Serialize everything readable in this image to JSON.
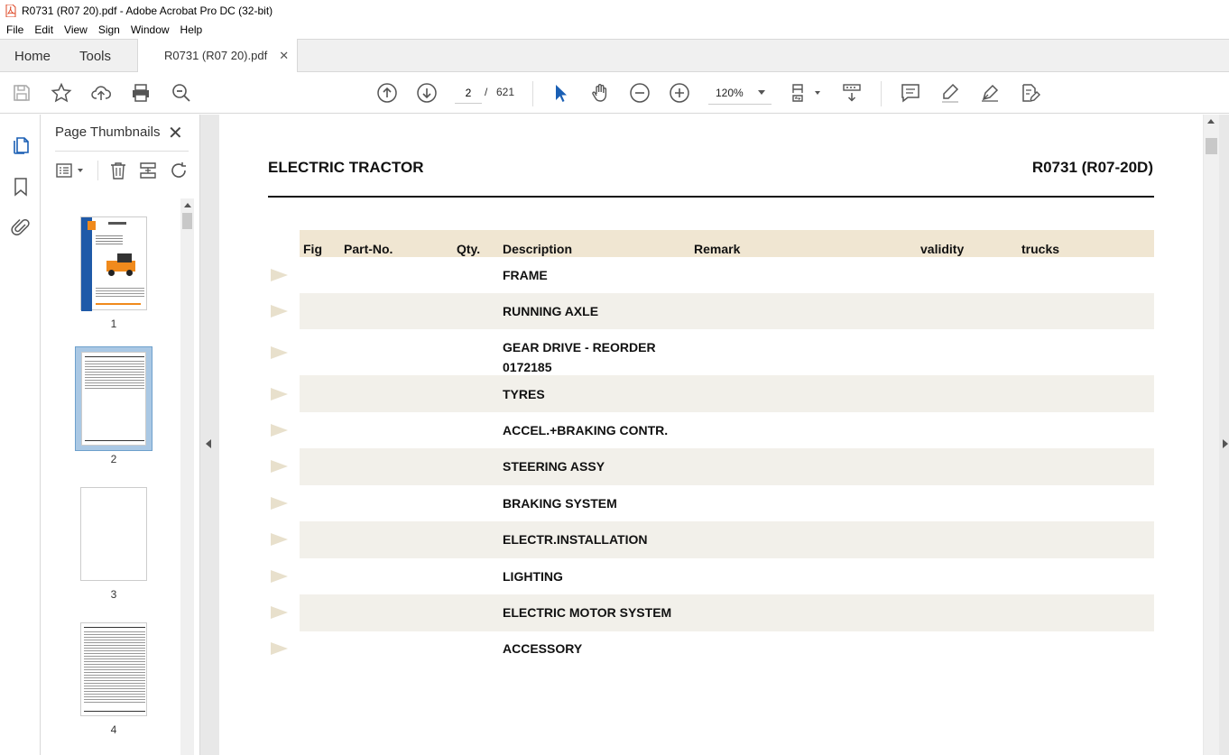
{
  "window": {
    "title": "R0731 (R07 20).pdf - Adobe Acrobat Pro DC (32-bit)"
  },
  "menu": [
    "File",
    "Edit",
    "View",
    "Sign",
    "Window",
    "Help"
  ],
  "tabs": {
    "home": "Home",
    "tools": "Tools",
    "document": "R0731 (R07 20).pdf"
  },
  "toolbar": {
    "page_current": "2",
    "page_separator": "/",
    "page_total": "621",
    "zoom": "120%"
  },
  "thumbnails": {
    "title": "Page Thumbnails",
    "pages": [
      "1",
      "2",
      "3",
      "4"
    ],
    "selected": "2"
  },
  "document": {
    "title": "ELECTRIC TRACTOR",
    "code": "R0731 (R07-20D)",
    "columns": [
      "Fig",
      "Part-No.",
      "Qty.",
      "Description",
      "Remark",
      "validity",
      "trucks"
    ],
    "rows": [
      "FRAME",
      "RUNNING AXLE",
      "GEAR DRIVE - REORDER 0172185",
      "TYRES",
      "ACCEL.+BRAKING CONTR.",
      "STEERING ASSY",
      "BRAKING SYSTEM",
      "ELECTR.INSTALLATION",
      "LIGHTING",
      "ELECTRIC MOTOR SYSTEM",
      "ACCESSORY"
    ]
  },
  "colors": {
    "header_bg": "#f0e6d2",
    "row_alt_bg": "#f2f0ea",
    "arrow": "#e8e0cc",
    "select_blue": "#aac8e4"
  }
}
